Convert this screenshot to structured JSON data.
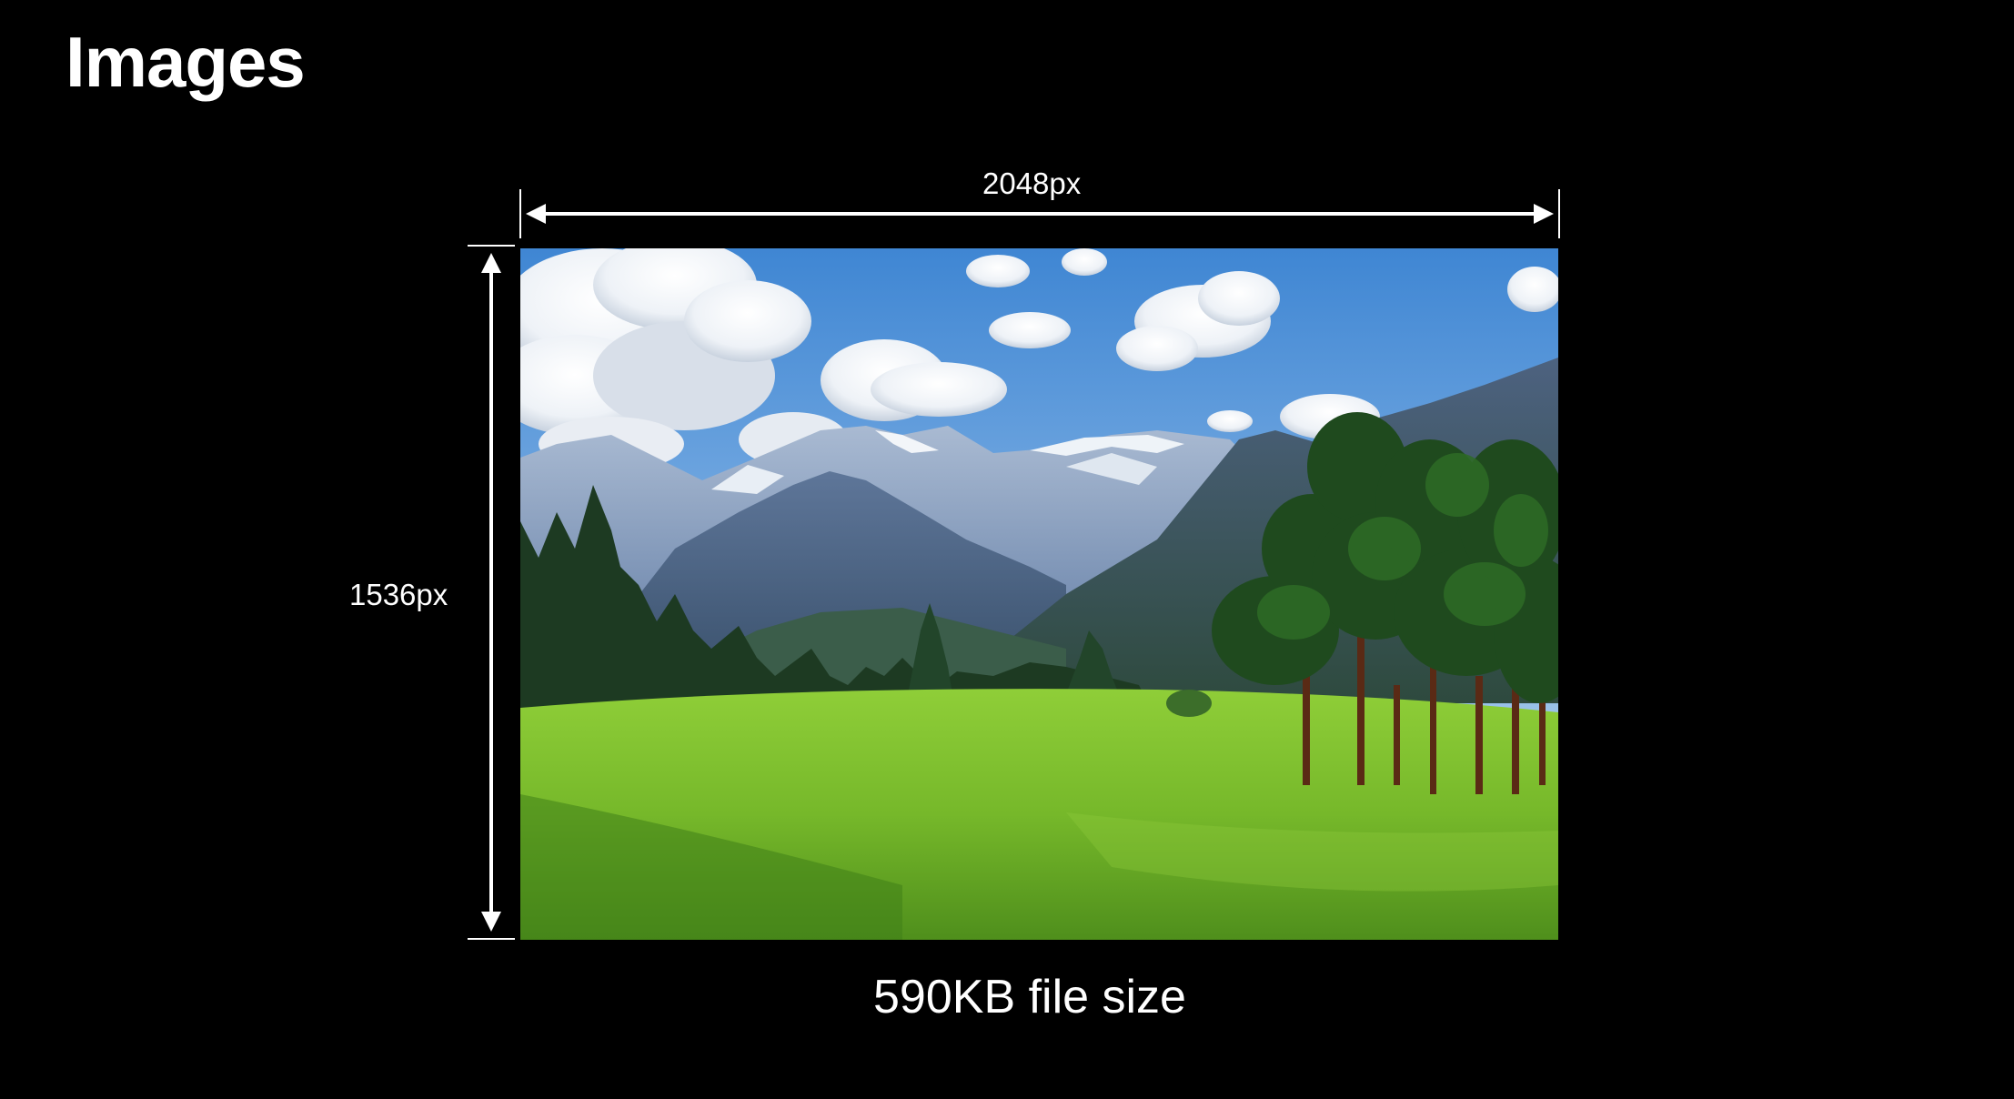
{
  "slide": {
    "title": "Images",
    "width_label": "2048px",
    "height_label": "1536px",
    "file_size_caption": "590KB file size"
  },
  "photo": {
    "subject": "mountain meadow landscape",
    "colors": {
      "sky_top": "#4a8fd6",
      "sky_bottom": "#bcd6ee",
      "mountain_far": "#8fa6c4",
      "mountain_mid": "#5a7196",
      "mountain_near": "#3c5270",
      "forest": "#1f3a24",
      "meadow_light": "#9bd43a",
      "meadow_dark": "#4f8f1c"
    }
  },
  "colors": {
    "background": "#000000",
    "foreground": "#ffffff"
  }
}
